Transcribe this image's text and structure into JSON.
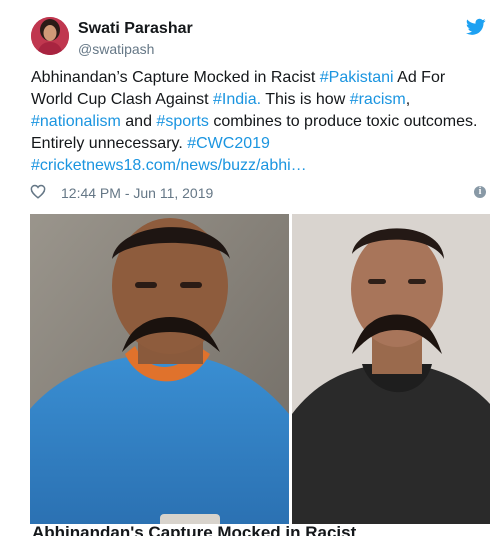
{
  "tweet": {
    "author_name": "Swati Parashar",
    "author_handle": "@swatipash",
    "text_lines": [
      [
        {
          "t": "Abhinandan’s Capture Mocked in Racist "
        },
        {
          "t": "#Pakistani",
          "tag": true
        },
        {
          "t": " Ad For"
        }
      ],
      [
        {
          "t": "World Cup Clash Against "
        },
        {
          "t": "#India.",
          "tag": true
        },
        {
          "t": " This is how "
        },
        {
          "t": "#racism",
          "tag": true
        },
        {
          "t": ","
        }
      ],
      [
        {
          "t": "#nationalism",
          "tag": true
        },
        {
          "t": " and "
        },
        {
          "t": "#sports",
          "tag": true
        },
        {
          "t": " combines to produce toxic outcomes."
        }
      ],
      [
        {
          "t": "Entirely unnecessary. "
        },
        {
          "t": "#CWC2019",
          "tag": true
        }
      ],
      [
        {
          "t": "#cricketnews18.com/news/buzz/abhi…",
          "tag": true
        }
      ]
    ],
    "timestamp": "12:44 PM - Jun 11, 2019",
    "info_glyph": "i",
    "link_card_title": "Abhinandan's Capture Mocked in Racist"
  },
  "icons": {
    "brand_bird": "twitter-bird-icon",
    "like": "heart-icon",
    "info": "info-icon"
  },
  "colors": {
    "link": "#1b95e0",
    "muted": "#657786",
    "text": "#14171a",
    "brand": "#1da1f2"
  }
}
